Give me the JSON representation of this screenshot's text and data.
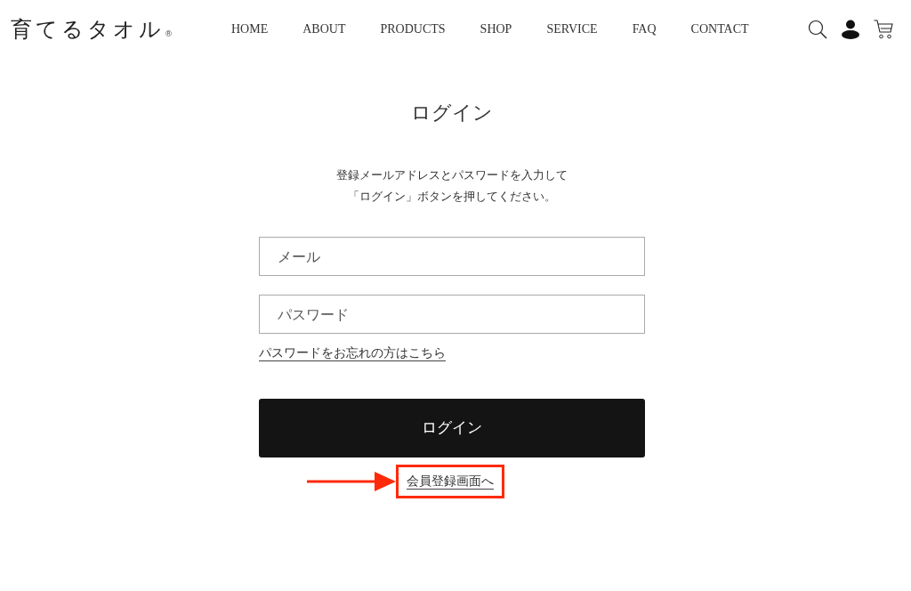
{
  "header": {
    "logo": {
      "text": "育てるタオル",
      "mark": "®"
    },
    "nav": [
      {
        "label": "HOME"
      },
      {
        "label": "ABOUT"
      },
      {
        "label": "PRODUCTS"
      },
      {
        "label": "SHOP"
      },
      {
        "label": "SERVICE"
      },
      {
        "label": "FAQ"
      },
      {
        "label": "CONTACT"
      }
    ]
  },
  "login": {
    "title": "ログイン",
    "instructions": [
      "登録メールアドレスとパスワードを入力して",
      "「ログイン」ボタンを押してください。"
    ],
    "fields": [
      {
        "placeholder": "メール"
      },
      {
        "placeholder": "パスワード"
      }
    ],
    "forgot_link": "パスワードをお忘れの方はこちら",
    "submit_button": "ログイン",
    "register_link": {
      "label": "会員登録画面へ",
      "highlighted": true
    }
  }
}
